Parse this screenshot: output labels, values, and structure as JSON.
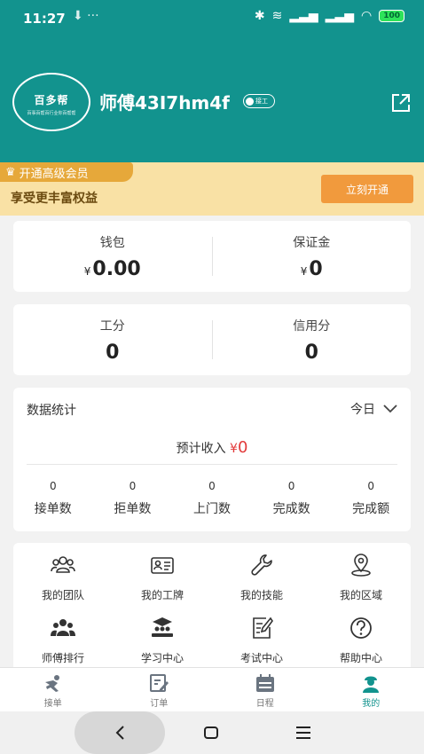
{
  "status_bar": {
    "time": "11:27",
    "extra": "⬇ ···",
    "battery": "100"
  },
  "profile": {
    "avatar_logo": "百多帮",
    "avatar_tagline": "百事百帮百行业你百帮帮",
    "username": "师傅43I7hm4f",
    "badge_text": "接工"
  },
  "vip": {
    "tag": "开通高级会员",
    "subtitle": "享受更丰富权益",
    "button": "立刻开通"
  },
  "wallet": {
    "wallet_label": "钱包",
    "wallet_currency": "¥",
    "wallet_value": "0.00",
    "deposit_label": "保证金",
    "deposit_currency": "¥",
    "deposit_value": "0"
  },
  "points": {
    "work_label": "工分",
    "work_value": "0",
    "credit_label": "信用分",
    "credit_value": "0"
  },
  "stats": {
    "title": "数据统计",
    "filter": "今日",
    "income_label": "预计收入",
    "income_currency": "¥",
    "income_value": "0",
    "items": [
      {
        "value": "0",
        "label": "接单数"
      },
      {
        "value": "0",
        "label": "拒单数"
      },
      {
        "value": "0",
        "label": "上门数"
      },
      {
        "value": "0",
        "label": "完成数"
      },
      {
        "value": "0",
        "label": "完成额"
      }
    ]
  },
  "menu": [
    {
      "label": "我的团队",
      "icon": "team-icon"
    },
    {
      "label": "我的工牌",
      "icon": "badge-card-icon"
    },
    {
      "label": "我的技能",
      "icon": "wrench-icon"
    },
    {
      "label": "我的区域",
      "icon": "location-icon"
    },
    {
      "label": "师傅排行",
      "icon": "ranking-icon"
    },
    {
      "label": "学习中心",
      "icon": "study-icon"
    },
    {
      "label": "考试中心",
      "icon": "exam-icon"
    },
    {
      "label": "帮助中心",
      "icon": "help-icon"
    }
  ],
  "tabbar": [
    {
      "label": "接单",
      "icon": "take-order-icon"
    },
    {
      "label": "订单",
      "icon": "orders-icon"
    },
    {
      "label": "日程",
      "icon": "calendar-icon"
    },
    {
      "label": "我的",
      "icon": "profile-icon",
      "active": true
    }
  ],
  "colors": {
    "primary": "#12938e",
    "vip_bg": "#f9e1a5",
    "vip_button": "#f19a3d",
    "money_red": "#e23a3a"
  }
}
